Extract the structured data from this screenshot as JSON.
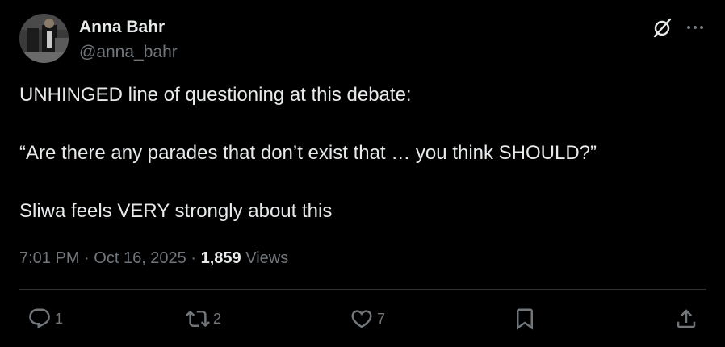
{
  "author": {
    "name": "Anna Bahr",
    "handle": "@anna_bahr"
  },
  "icons": {
    "grok": "grok-icon",
    "more": "more-horizontal-icon",
    "reply": "reply-icon",
    "repost": "repost-icon",
    "like": "heart-icon",
    "bookmark": "bookmark-icon",
    "share": "share-icon"
  },
  "tweet": {
    "paragraphs": [
      "UNHINGED line of questioning at this debate:",
      "“Are there any parades that don’t exist that … you think SHOULD?”",
      "Sliwa feels VERY strongly about this"
    ]
  },
  "meta": {
    "time": "7:01 PM",
    "separator": "·",
    "date": "Oct 16, 2025",
    "views_count": "1,859",
    "views_label": "Views"
  },
  "actions": {
    "replies": "1",
    "reposts": "2",
    "likes": "7"
  },
  "colors": {
    "background": "#000000",
    "text": "#e7e9ea",
    "secondary": "#71767b",
    "divider": "#2f3336"
  }
}
